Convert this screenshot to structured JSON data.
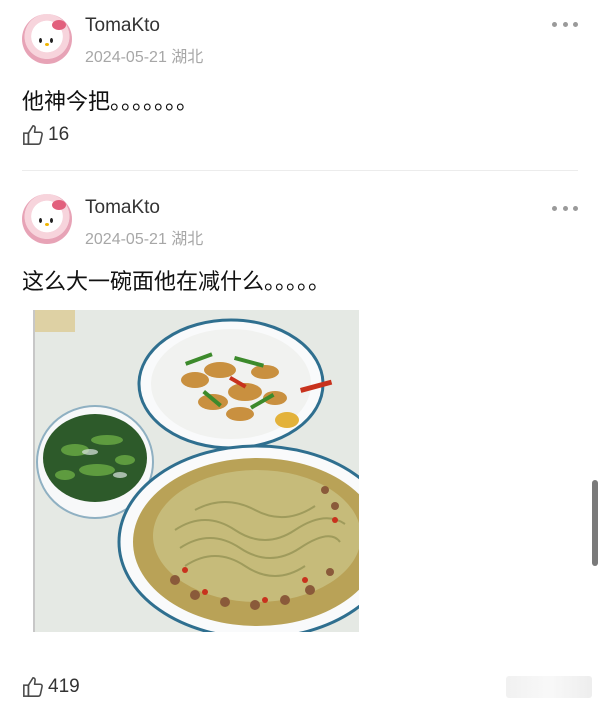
{
  "posts": [
    {
      "username": "TomaKto",
      "date": "2024-05-21",
      "location": "湖北",
      "content": "他神今把。。。。。。。",
      "likes": "16"
    },
    {
      "username": "TomaKto",
      "date": "2024-05-21",
      "location": "湖北",
      "content": "这么大一碗面他在减什么。。。。。",
      "likes": "419"
    }
  ],
  "icons": {
    "more": "more-icon",
    "like": "thumbs-up-icon"
  }
}
